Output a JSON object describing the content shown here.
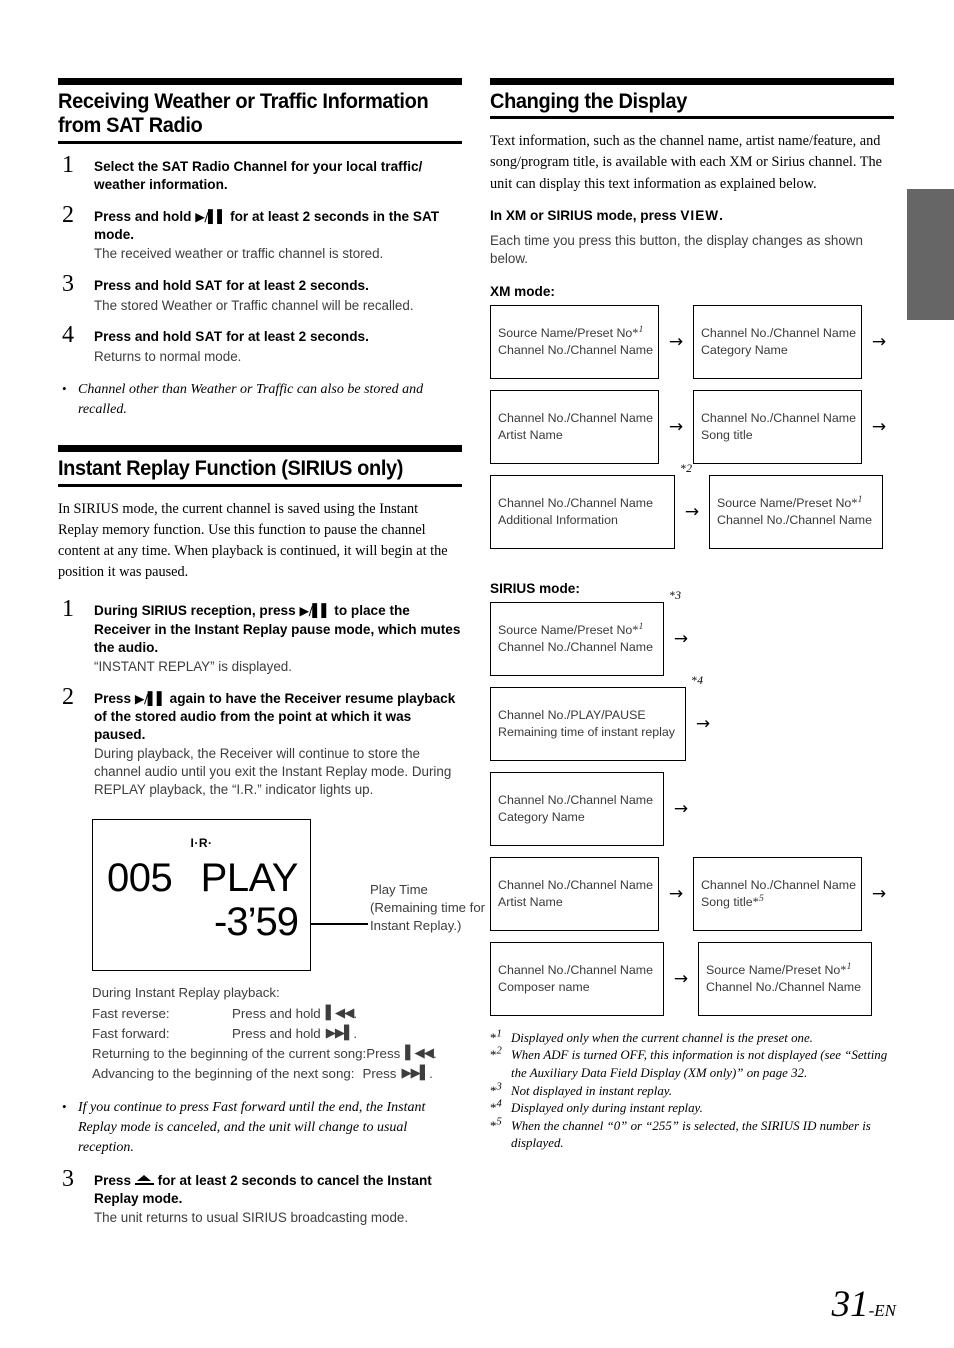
{
  "page": {
    "number": "31",
    "suffix": "-EN"
  },
  "left_column": {
    "section1": {
      "heading": "Receiving Weather or Traffic Information from SAT Radio",
      "steps": [
        {
          "num": "1",
          "title_pre": "Select the SAT Radio Channel for your local traffic/ weather information.",
          "body": ""
        },
        {
          "num": "2",
          "title_pre": "Press and hold ",
          "glyph": "play-pause",
          "title_post": " for at least 2 seconds in the SAT mode.",
          "body": "The received weather or traffic channel is stored."
        },
        {
          "num": "3",
          "title_pre": "Press and hold ",
          "keyword": "SAT",
          "title_post": " for at least 2 seconds.",
          "body": "The stored Weather or Traffic channel will be recalled."
        },
        {
          "num": "4",
          "title_pre": "Press and hold ",
          "keyword": "SAT",
          "title_post": " for at least 2 seconds.",
          "body": "Returns to normal mode."
        }
      ],
      "note": "Channel other than Weather or Traffic can also be stored and recalled."
    },
    "section2": {
      "heading": "Instant Replay Function (SIRIUS only)",
      "intro": "In SIRIUS mode, the current channel is saved using the Instant Replay memory function. Use this function to pause the channel content at any time. When playback is continued, it will begin at the position it was paused.",
      "steps": [
        {
          "num": "1",
          "title_pre": "During SIRIUS reception, press ",
          "glyph": "play-pause",
          "title_post": " to place the Receiver in the Instant Replay pause mode, which mutes the audio.",
          "body": "“INSTANT REPLAY” is displayed."
        },
        {
          "num": "2",
          "title_pre": "Press ",
          "glyph": "play-pause",
          "title_post": " again to have the Receiver resume playback of the stored audio from the point at which it was paused.",
          "body": "During playback, the Receiver will continue to store the channel audio until you exit the Instant Replay mode. During REPLAY playback, the “I.R.” indicator lights up."
        },
        {
          "num": "3",
          "title_pre": "Press ",
          "glyph": "eject",
          "title_post": " for at least 2 seconds to cancel the Instant Replay mode.",
          "body": "The unit returns to usual SIRIUS broadcasting mode."
        }
      ],
      "note": "If you continue to press Fast forward until the end, the Instant Replay mode is canceled, and the unit will change to usual reception."
    },
    "lcd_figure": {
      "indicator": "I·R·",
      "channel": "005",
      "status": "PLAY",
      "time": "-3’59",
      "caption": "Play Time (Remaining time for Instant Replay.)"
    },
    "key_list": {
      "header": "During Instant Replay playback:",
      "rows": [
        {
          "label": "Fast reverse:",
          "action": "Press and hold",
          "icon": "rewind-icon",
          "tail": "."
        },
        {
          "label": "Fast forward:",
          "action": "Press and hold",
          "icon": "fastforward-icon",
          "tail": "."
        },
        {
          "label": "Returning to the beginning of the current song:",
          "action": "Press",
          "icon": "rewind-icon",
          "tail": "."
        },
        {
          "label": "Advancing to the beginning of the next song:",
          "action": "Press",
          "icon": "fastforward-icon",
          "tail": "."
        }
      ]
    }
  },
  "right_column": {
    "heading": "Changing the Display",
    "intro": "Text information, such as the channel name, artist name/feature, and song/program title, is available with each XM or Sirius channel. The unit can display this text information as explained below.",
    "instruction_pre": "In XM or SIRIUS mode, press ",
    "instruction_kw": "VIEW",
    "instruction_post": ".",
    "instruction_body": "Each time you press this button, the display changes as shown below.",
    "xm_label": "XM mode:",
    "xm_flow": [
      {
        "boxes": [
          {
            "lines": [
              "Source Name/Preset No*1",
              "Channel No./Channel Name"
            ],
            "fn": "",
            "width": "w-174"
          },
          {
            "lines": [
              "Channel No./Channel Name",
              "Category Name"
            ],
            "fn": "",
            "width": "w-174"
          }
        ]
      },
      {
        "boxes": [
          {
            "lines": [
              "Channel No./Channel Name",
              "Artist Name"
            ],
            "fn": "",
            "width": "w-174"
          },
          {
            "lines": [
              "Channel No./Channel Name",
              "Song title"
            ],
            "fn": "",
            "width": "w-174"
          }
        ]
      },
      {
        "boxes": [
          {
            "lines": [
              "Channel No./Channel Name",
              "Additional Information"
            ],
            "fn": "2",
            "width": "w-185"
          },
          {
            "lines": [
              "Source Name/Preset No*1",
              "Channel No./Channel Name"
            ],
            "fn": "",
            "width": "w-174"
          }
        ]
      }
    ],
    "sirius_label": "SIRIUS mode:",
    "sirius_flow": [
      {
        "boxes": [
          {
            "lines": [
              "Source Name/Preset No*1",
              "Channel No./Channel Name"
            ],
            "fn": "3",
            "width": "w-174"
          }
        ]
      },
      {
        "boxes": [
          {
            "lines": [
              "Channel No./PLAY/PAUSE",
              "Remaining time of instant replay"
            ],
            "fn": "4",
            "width": "w-196"
          }
        ]
      },
      {
        "boxes": [
          {
            "lines": [
              "Channel No./Channel Name",
              "Category Name"
            ],
            "fn": "",
            "width": "w-174"
          }
        ]
      },
      {
        "boxes": [
          {
            "lines": [
              "Channel No./Channel Name",
              "Artist Name"
            ],
            "fn": "",
            "width": "w-174"
          },
          {
            "lines": [
              "Channel No./Channel Name",
              "Song title*5"
            ],
            "fn": "",
            "width": "w-174"
          }
        ]
      },
      {
        "boxes": [
          {
            "lines": [
              "Channel No./Channel Name",
              "Composer name"
            ],
            "fn": "",
            "width": "w-174"
          },
          {
            "lines": [
              "Source Name/Preset No*1",
              "Channel No./Channel Name"
            ],
            "fn": "",
            "width": "w-174"
          }
        ]
      }
    ],
    "footnotes": [
      {
        "mark": "1",
        "text": "Displayed only when the current channel is the preset one."
      },
      {
        "mark": "2",
        "text": "When ADF is turned OFF, this information is not displayed (see “Setting the Auxiliary Data Field Display (XM only)” on page 32."
      },
      {
        "mark": "3",
        "text": "Not displayed in instant replay."
      },
      {
        "mark": "4",
        "text": "Displayed only during instant replay."
      },
      {
        "mark": "5",
        "text": "When the channel “0” or “255” is selected, the SIRIUS ID number is displayed."
      }
    ]
  },
  "colors": {
    "edge_tab": "#666666",
    "rule": "#000000",
    "body_gray": "#3d3d3d"
  }
}
